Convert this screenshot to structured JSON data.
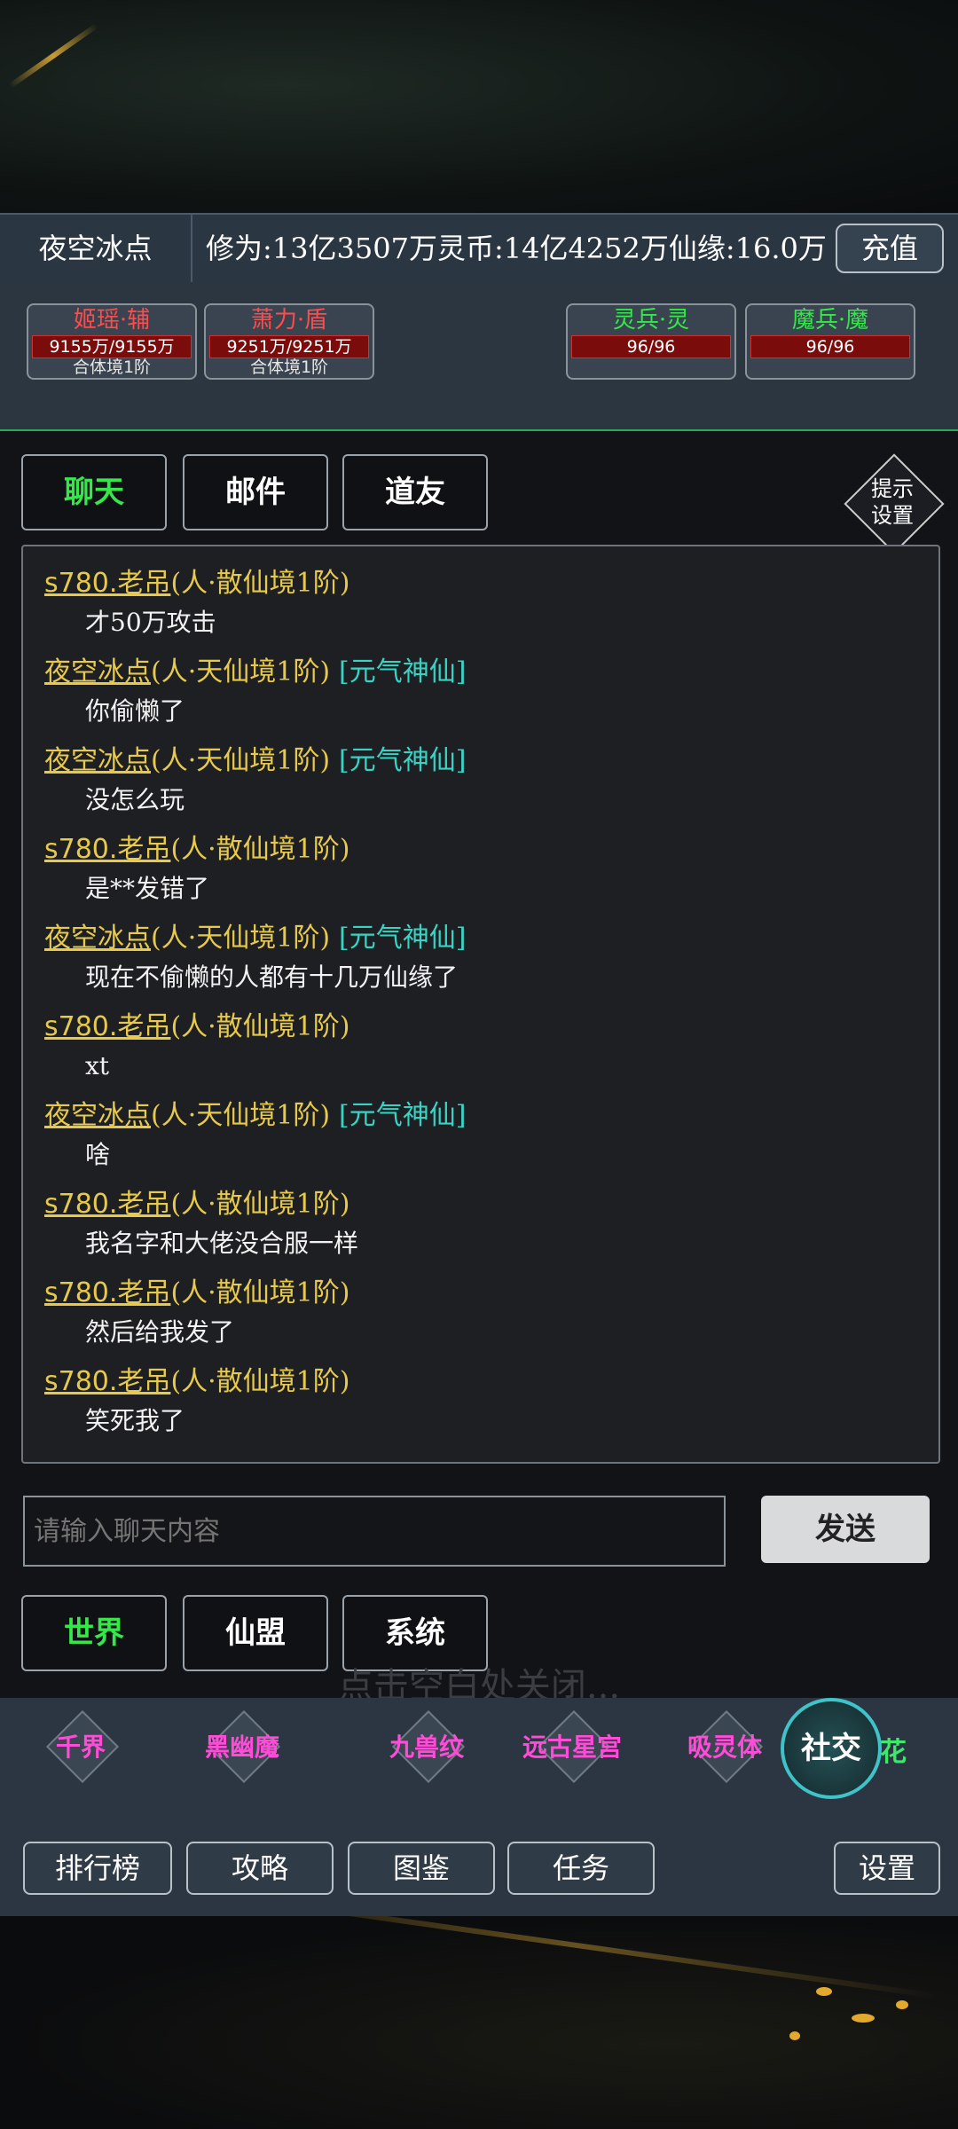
{
  "player": {
    "name": "夜空冰点",
    "stats": "修为:13亿3507万灵币:14亿4252万仙缘:16.0万",
    "recharge_label": "充值"
  },
  "team": [
    {
      "name": "姬瑶·辅",
      "hp": "9155万/9155万",
      "realm": "合体境1阶",
      "name_color": "#ff4b4b"
    },
    {
      "name": "萧力·盾",
      "hp": "9251万/9251万",
      "realm": "合体境1阶",
      "name_color": "#ff4b4b"
    },
    {
      "name": "灵兵·灵",
      "hp": "96/96",
      "realm": "",
      "name_color": "#35e84a"
    },
    {
      "name": "魔兵·魔",
      "hp": "96/96",
      "realm": "",
      "name_color": "#35e84a"
    }
  ],
  "tabs": {
    "chat": "聊天",
    "mail": "邮件",
    "friends": "道友",
    "hint_settings_line1": "提示",
    "hint_settings_line2": "设置"
  },
  "messages": [
    {
      "user": "s780.老吊",
      "rank": "(人·散仙境1阶)",
      "tag": "",
      "text": "才50万攻击"
    },
    {
      "user": "夜空冰点",
      "rank": "(人·天仙境1阶)",
      "tag": "[元气神仙]",
      "text": "你偷懒了"
    },
    {
      "user": "夜空冰点",
      "rank": "(人·天仙境1阶)",
      "tag": "[元气神仙]",
      "text": "没怎么玩"
    },
    {
      "user": "s780.老吊",
      "rank": "(人·散仙境1阶)",
      "tag": "",
      "text": "是**发错了"
    },
    {
      "user": "夜空冰点",
      "rank": "(人·天仙境1阶)",
      "tag": "[元气神仙]",
      "text": "现在不偷懒的人都有十几万仙缘了"
    },
    {
      "user": "s780.老吊",
      "rank": "(人·散仙境1阶)",
      "tag": "",
      "text": "xt"
    },
    {
      "user": "夜空冰点",
      "rank": "(人·天仙境1阶)",
      "tag": "[元气神仙]",
      "text": "啥"
    },
    {
      "user": "s780.老吊",
      "rank": "(人·散仙境1阶)",
      "tag": "",
      "text": "我名字和大佬没合服一样"
    },
    {
      "user": "s780.老吊",
      "rank": "(人·散仙境1阶)",
      "tag": "",
      "text": "然后给我发了"
    },
    {
      "user": "s780.老吊",
      "rank": "(人·散仙境1阶)",
      "tag": "",
      "text": "笑死我了"
    }
  ],
  "input": {
    "placeholder": "请输入聊天内容",
    "send_label": "发送"
  },
  "channels": {
    "world": "世界",
    "alliance": "仙盟",
    "system": "系统"
  },
  "close_hint": "点击空白处关闭...",
  "realms": [
    "千界",
    "黑幽魔",
    "九兽纹",
    "远古星宫",
    "吸灵体"
  ],
  "social_label": "社交",
  "flower_label": "花",
  "nav": {
    "ranking": "排行榜",
    "guide": "攻略",
    "codex": "图鉴",
    "tasks": "任务",
    "settings": "设置"
  }
}
